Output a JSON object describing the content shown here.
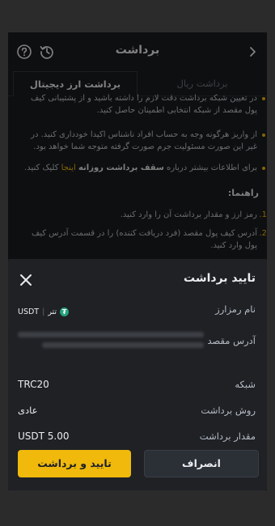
{
  "header": {
    "title": "برداشت",
    "back_icon": "chevron-right-icon",
    "history_icon": "history-icon",
    "help_icon": "help-icon"
  },
  "tabs": [
    {
      "label": "برداشت ریال",
      "active": false
    },
    {
      "label": "برداشت ارز دیجیتال",
      "active": true
    }
  ],
  "notes": {
    "note1": "در تعیین شبکه برداشت دقت لازم را داشته باشید و از پشتیبانی کیف پول مقصد از شبکه انتخابی اطمینان حاصل کنید.",
    "note2": "از واریز هرگونه وجه به حساب افراد ناشناس اکیدا خودداری کنید. در غیر این صورت مسئولیت جرم صورت گرفته متوجه شما خواهد بود.",
    "note3_pre": "برای اطلاعات بیشتر درباره ",
    "note3_bold": "سقف برداشت روزانه",
    "note3_link": "اینجا",
    "note3_post": " کلیک کنید."
  },
  "guide": {
    "title": "راهنما:",
    "steps": [
      {
        "num": "1.",
        "text": "رمز ارز و مقدار برداشت آن را وارد کنید."
      },
      {
        "num": "2.",
        "text": "آدرس کیف پول مقصد (فرد دریافت کننده) را در قسمت آدرس کیف پول وارد کنید."
      }
    ]
  },
  "sheet": {
    "title": "تایید برداشت",
    "rows": {
      "asset": {
        "label": "نام رمزارز",
        "name": "تتر",
        "symbol": "USDT",
        "coin_glyph": "₮"
      },
      "address": {
        "label": "آدرس مقصد"
      },
      "network": {
        "label": "شبکه",
        "value": "TRC20"
      },
      "method": {
        "label": "روش برداشت",
        "value": "عادی"
      },
      "amount": {
        "label": "مقدار برداشت",
        "value": "USDT 5.00"
      }
    },
    "confirm_label": "تایید و برداشت",
    "cancel_label": "انصراف"
  },
  "colors": {
    "accent": "#f0b90b",
    "tether_green": "#26a17b",
    "background": "#1a1c20"
  }
}
